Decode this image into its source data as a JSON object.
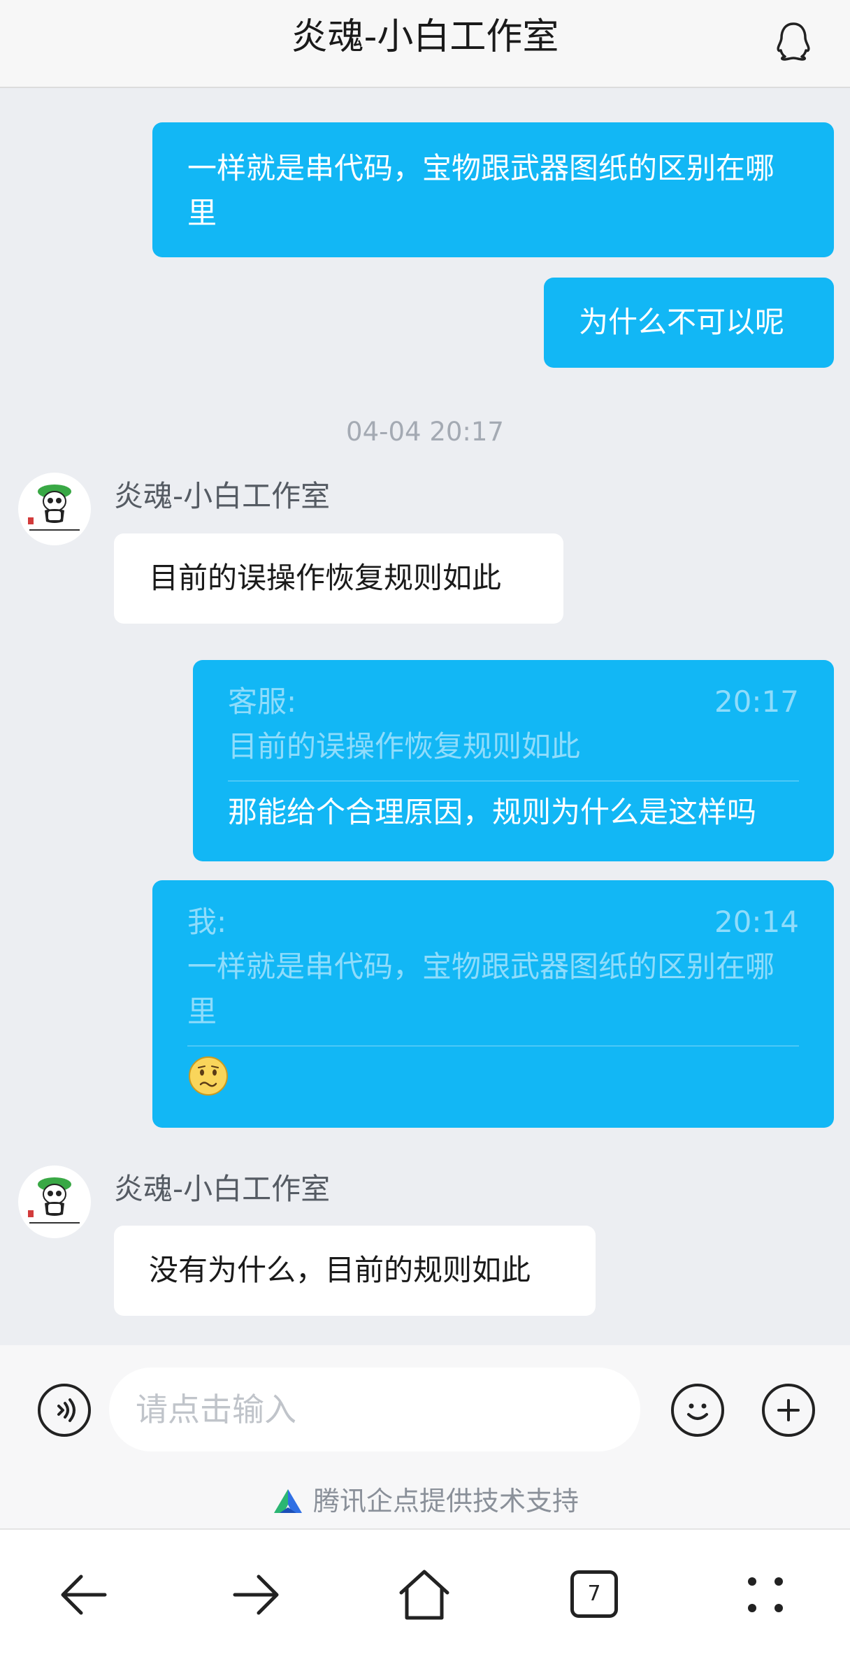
{
  "header": {
    "title": "炎魂-小白工作室"
  },
  "messages": {
    "m1": "一样就是串代码，宝物跟武器图纸的区别在哪里",
    "m2": "为什么不可以呢",
    "timestamp": "04-04 20:17",
    "agent_name": "炎魂-小白工作室",
    "m3": "目前的误操作恢复规则如此",
    "m4": {
      "quote_sender": "客服:",
      "quote_time": "20:17",
      "quote_text": "目前的误操作恢复规则如此",
      "text": "那能给个合理原因，规则为什么是这样吗"
    },
    "m5": {
      "quote_sender": "我:",
      "quote_time": "20:14",
      "quote_text": "一样就是串代码，宝物跟武器图纸的区别在哪里",
      "emoji": "confused-face-emoji"
    },
    "m6": "没有为什么，目前的规则如此"
  },
  "composer": {
    "placeholder": "请点击输入",
    "powered_by": "腾讯企点提供技术支持"
  },
  "navbar": {
    "tab_count": "7"
  }
}
